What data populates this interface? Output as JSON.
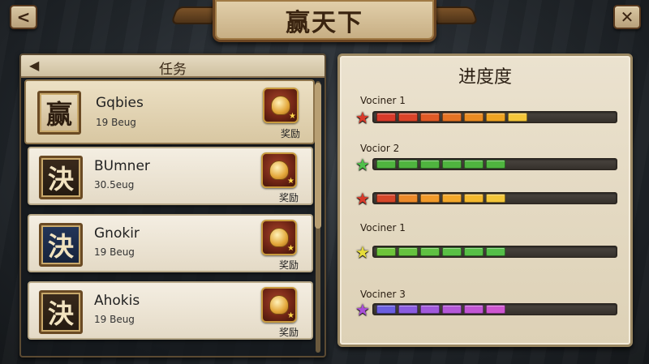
{
  "header": {
    "title": "赢天下",
    "back_glyph": "<",
    "close_glyph": "✕"
  },
  "tasks_panel": {
    "title": "任务",
    "back_glyph": "◀",
    "reward_label": "奖励",
    "items": [
      {
        "badge": "赢",
        "name": "Gqbies",
        "sub": "19 Beug",
        "badge_style": "win",
        "active": true
      },
      {
        "badge": "決",
        "name": "BUmner",
        "sub": "30.5eug",
        "badge_style": "dark",
        "active": false
      },
      {
        "badge": "決",
        "name": "Gnokir",
        "sub": "19 Beug",
        "badge_style": "blue",
        "active": false
      },
      {
        "badge": "決",
        "name": "Ahokis",
        "sub": "19 Beug",
        "badge_style": "dark",
        "active": false
      }
    ]
  },
  "progress_panel": {
    "title": "进度度",
    "bars": [
      {
        "label": "Vociner 1",
        "star_color": "#d83a2a",
        "filled": 7,
        "total": 11,
        "colors": [
          "#d83a2a",
          "#db4429",
          "#e05a26",
          "#e57324",
          "#ea8b22",
          "#efa422",
          "#f4c63a"
        ]
      },
      {
        "label": "Vocior 2",
        "star_color": "#4ec04a",
        "filled": 6,
        "total": 11,
        "colors": [
          "#4fb43f",
          "#4fb43f",
          "#4fb43f",
          "#4fb43f",
          "#4fb43f",
          "#4fb43f"
        ]
      },
      {
        "label": "",
        "star_color": "#d83a2a",
        "filled": 6,
        "total": 11,
        "colors": [
          "#d5462a",
          "#ec8a2a",
          "#f19a2a",
          "#f3a82b",
          "#f4b92e",
          "#f3c63a"
        ]
      },
      {
        "label": "Vociner 1",
        "star_color": "#e6dc3a",
        "filled": 6,
        "total": 11,
        "colors": [
          "#6ec43a",
          "#66c23f",
          "#5fc142",
          "#5ac045",
          "#57bf46",
          "#54be48"
        ]
      },
      {
        "label": "Vociner 3",
        "star_color": "#a94fd8",
        "filled": 6,
        "total": 11,
        "colors": [
          "#6b5fe0",
          "#8a5ce0",
          "#a159dc",
          "#b458d8",
          "#c256d4",
          "#ce56d0"
        ]
      }
    ]
  }
}
